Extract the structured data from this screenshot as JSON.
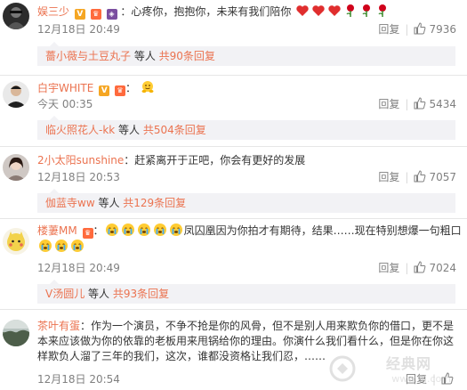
{
  "comments": [
    {
      "user": "娱三少",
      "colon": "：",
      "text": "心疼你，抱抱你，未来有我们陪你",
      "emojis": [
        "heart",
        "heart",
        "heart",
        "rose",
        "rose",
        "rose"
      ],
      "time": "12月18日 20:49",
      "reply_label": "回复",
      "likes": "7936",
      "reply_user": "薔小薇与土豆丸子",
      "reply_mid": " 等人 ",
      "reply_count": "共90条回复"
    },
    {
      "user": "白宇WHITE",
      "colon": "：",
      "emojis": [
        "hug"
      ],
      "time": "今天 00:35",
      "reply_label": "回复",
      "likes": "5434",
      "reply_user": "临火照花人-kk",
      "reply_mid": " 等人 ",
      "reply_count": "共504条回复"
    },
    {
      "user": "2小太阳sunshine",
      "colon": "：",
      "text": "赶紧离开于正吧，你会有更好的发展",
      "time": "12月18日 20:53",
      "reply_label": "回复",
      "likes": "7057",
      "reply_user": "伽蓝寺ww",
      "reply_mid": " 等人 ",
      "reply_count": "共129条回复"
    },
    {
      "user": "楼萋MM",
      "colon": "：",
      "text": "凤囚凰因为你拍才有期待，结果……现在特别想爆一句粗口",
      "emojis_before": [
        "cry",
        "cry",
        "cry",
        "cry",
        "cry"
      ],
      "emojis_after": [
        "cry",
        "cry",
        "cry"
      ],
      "time": "12月18日 20:49",
      "reply_label": "回复",
      "likes": "7024",
      "reply_user": "V汤圆儿",
      "reply_mid": " 等人 ",
      "reply_count": "共93条回复"
    },
    {
      "user": "茶叶有蛋",
      "colon": "：",
      "text": "作为一个演员，不争不抢是你的风骨，但不是别人用来欺负你的借口，更不是本来应该做为你的依靠的老板用来甩锅给你的理由。你演什么我们看什么，但是你在你这样欺负人溜了三年的我们，这次，谁都没资格让我们忍，……",
      "time": "12月18日 20:54",
      "reply_label": "回复"
    }
  ],
  "watermark": {
    "text": "经典网",
    "url": "www.3J.com"
  },
  "colors": {
    "username": "#eb7350",
    "time": "#808080",
    "reply_bg": "#f2f2f5"
  }
}
